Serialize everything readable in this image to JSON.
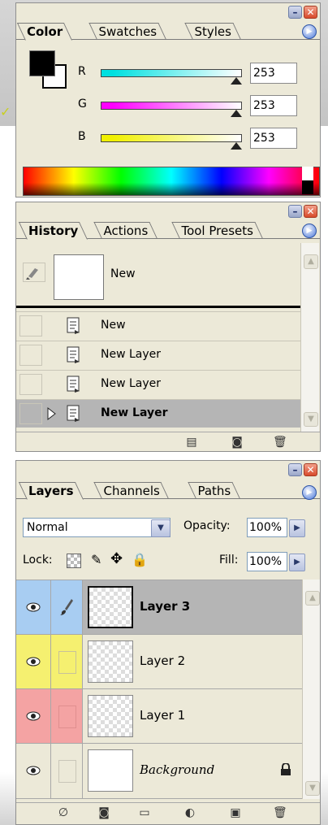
{
  "color_panel": {
    "tabs": [
      "Color",
      "Swatches",
      "Styles"
    ],
    "active_tab": "Color",
    "foreground_color": "#000000",
    "background_color": "#fdfdfd",
    "channels": [
      {
        "label": "R",
        "value": "253",
        "gradient": [
          "#ffffff",
          "#00e0e0"
        ]
      },
      {
        "label": "G",
        "value": "253",
        "gradient": [
          "#ffffff",
          "#ff00ff"
        ]
      },
      {
        "label": "B",
        "value": "253",
        "gradient": [
          "#ffffff",
          "#f0f000"
        ]
      }
    ]
  },
  "history_panel": {
    "tabs": [
      "History",
      "Actions",
      "Tool Presets"
    ],
    "active_tab": "History",
    "snapshot_label": "New",
    "states": [
      {
        "label": "New",
        "active": false
      },
      {
        "label": "New Layer",
        "active": false
      },
      {
        "label": "New Layer",
        "active": false
      },
      {
        "label": "New Layer",
        "active": true
      }
    ],
    "bottom_icons": [
      "new-document-from-state-icon",
      "camera-snapshot-icon",
      "trash-icon"
    ]
  },
  "layers_panel": {
    "tabs": [
      "Layers",
      "Channels",
      "Paths"
    ],
    "active_tab": "Layers",
    "blend_mode": "Normal",
    "opacity_label": "Opacity:",
    "opacity_value": "100%",
    "lock_label": "Lock:",
    "fill_label": "Fill:",
    "fill_value": "100%",
    "layers": [
      {
        "name": "Layer 3",
        "color": "#a8cdf2",
        "selected": true,
        "locked": false
      },
      {
        "name": "Layer 2",
        "color": "#f5f070",
        "selected": false,
        "locked": false
      },
      {
        "name": "Layer 1",
        "color": "#f4a3a3",
        "selected": false,
        "locked": false
      },
      {
        "name": "Background",
        "color": "#ece9d8",
        "selected": false,
        "locked": true
      }
    ],
    "bottom_icons": [
      "link-icon",
      "layer-mask-icon",
      "folder-icon",
      "adjustment-layer-icon",
      "new-layer-icon",
      "trash-icon"
    ]
  }
}
